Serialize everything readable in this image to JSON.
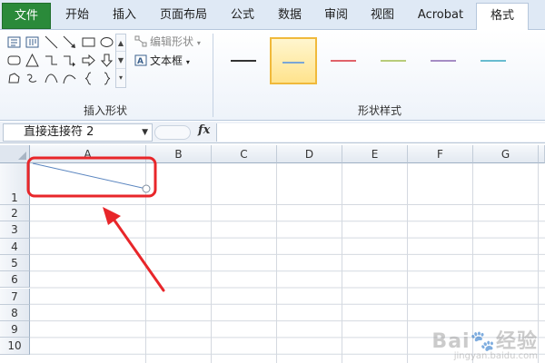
{
  "ribbon": {
    "tabs": [
      {
        "label": "文件"
      },
      {
        "label": "开始"
      },
      {
        "label": "插入"
      },
      {
        "label": "页面布局"
      },
      {
        "label": "公式"
      },
      {
        "label": "数据"
      },
      {
        "label": "审阅"
      },
      {
        "label": "视图"
      },
      {
        "label": "Acrobat"
      },
      {
        "label": "格式"
      }
    ],
    "active_tab": "格式",
    "file_tab_color": "#2a8a3a",
    "insert_shapes": {
      "label": "插入形状",
      "edit_shape_label": "编辑形状",
      "text_box_label": "文本框",
      "shape_icons": [
        "text-box-icon",
        "vertical-text-box-icon",
        "line-icon",
        "arrow-line-icon",
        "rectangle-icon",
        "oval-icon",
        "rounded-rectangle-icon",
        "triangle-icon",
        "elbow-connector-icon",
        "elbow-arrow-connector-icon",
        "right-arrow-icon",
        "down-arrow-icon",
        "freeform-icon",
        "scribble-icon",
        "curve-icon",
        "arc-icon",
        "left-brace-icon",
        "right-brace-icon"
      ]
    },
    "shape_styles": {
      "label": "形状样式",
      "swatches": [
        {
          "color": "#333333",
          "selected": false
        },
        {
          "color": "#7aa6d6",
          "selected": true
        },
        {
          "color": "#e0626a",
          "selected": false
        },
        {
          "color": "#b8cc7a",
          "selected": false
        },
        {
          "color": "#a58cc4",
          "selected": false
        },
        {
          "color": "#68bcd0",
          "selected": false
        },
        {
          "color": "#f2a65a",
          "selected": false
        }
      ],
      "selected_border_color": "#f0b93b"
    }
  },
  "formula_bar": {
    "name_box_value": "直接连接符 2",
    "fx_label": "fx",
    "formula_value": ""
  },
  "sheet": {
    "columns": [
      "A",
      "B",
      "C",
      "D",
      "E",
      "F",
      "G"
    ],
    "rows": [
      "1",
      "2",
      "3",
      "4",
      "5",
      "6",
      "7",
      "8",
      "9",
      "10"
    ],
    "shape": {
      "type": "straight-connector",
      "color": "#5b86c0",
      "anchor_cell": "A1"
    },
    "annotation_color": "#e8262a"
  },
  "watermark": {
    "text": "Bai@经验",
    "sub": "jingyan.baidu.com"
  }
}
